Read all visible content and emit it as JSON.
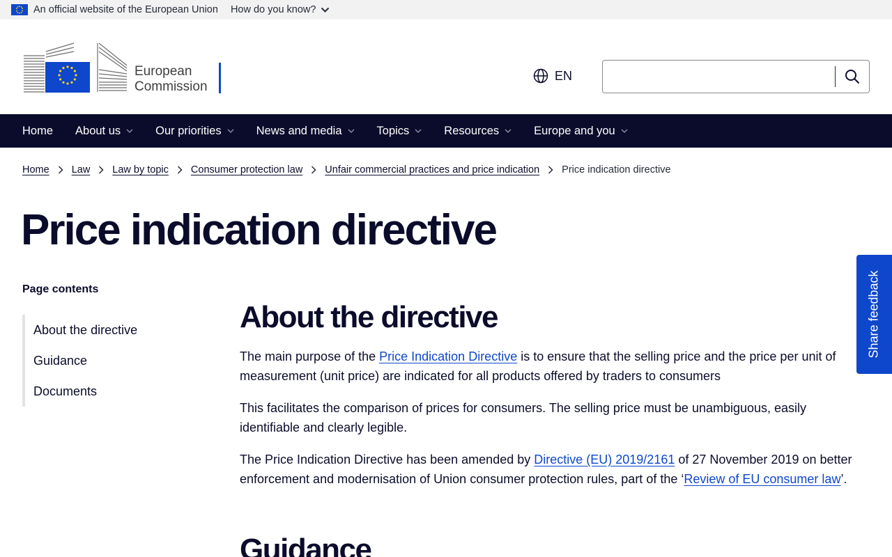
{
  "eu_banner": {
    "official_text": "An official website of the European Union",
    "how_know_text": "How do you know?"
  },
  "header": {
    "logo_line1": "European",
    "logo_line2": "Commission",
    "language": "EN",
    "search_value": ""
  },
  "nav": {
    "items": [
      {
        "label": "Home",
        "dropdown": false
      },
      {
        "label": "About us",
        "dropdown": true
      },
      {
        "label": "Our priorities",
        "dropdown": true
      },
      {
        "label": "News and media",
        "dropdown": true
      },
      {
        "label": "Topics",
        "dropdown": true
      },
      {
        "label": "Resources",
        "dropdown": true
      },
      {
        "label": "Europe and you",
        "dropdown": true
      }
    ]
  },
  "breadcrumb": {
    "links": [
      "Home",
      "Law",
      "Law by topic",
      "Consumer protection law",
      "Unfair commercial practices and price indication"
    ],
    "current": "Price indication directive"
  },
  "page": {
    "title": "Price indication directive"
  },
  "toc": {
    "heading": "Page contents",
    "items": [
      "About the directive",
      "Guidance",
      "Documents"
    ]
  },
  "content": {
    "section1_heading": "About the directive",
    "p1_before": "The main purpose of the ",
    "p1_link": "Price Indication Directive",
    "p1_after": " is to ensure that the selling price and the price per unit of measurement (unit price) are indicated for all products offered by traders to consumers",
    "p2": "This facilitates the comparison of prices for consumers. The selling price must be unambiguous, easily identifiable and clearly legible.",
    "p3_before": "The Price Indication Directive has been amended by ",
    "p3_link1": "Directive (EU) 2019/2161",
    "p3_middle": " of 27 November 2019 on better enforcement and modernisation of Union consumer protection rules, part of the ‘",
    "p3_link2": "Review of EU consumer law",
    "p3_after": "’.",
    "section2_heading": "Guidance"
  },
  "feedback": {
    "label": "Share feedback"
  },
  "colors": {
    "nav_bg": "#0b0c2b",
    "eu_blue": "#0e47cb",
    "link": "#0e47cb",
    "text": "#0b0c2b",
    "banner_bg": "#f2f2f2"
  }
}
